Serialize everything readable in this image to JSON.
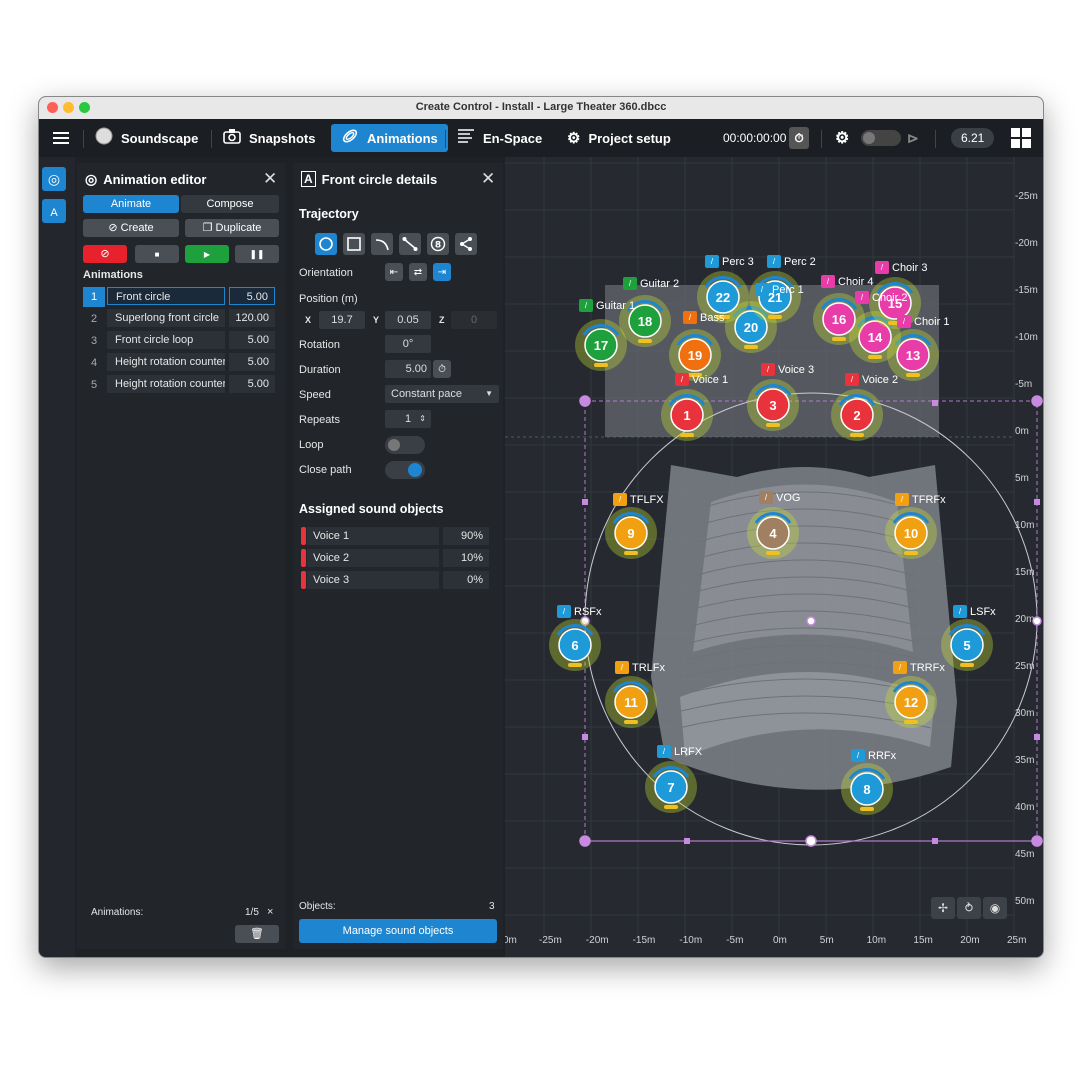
{
  "window": {
    "title": "Create Control - Install - Large Theater 360.dbcc"
  },
  "menubar": {
    "items": [
      {
        "label": "Soundscape",
        "icon": "soundscape-icon"
      },
      {
        "label": "Snapshots",
        "icon": "camera-icon"
      },
      {
        "label": "Animations",
        "icon": "animations-icon",
        "active": true
      },
      {
        "label": "En-Space",
        "icon": "en-space-icon"
      },
      {
        "label": "Project setup",
        "icon": "gears-icon"
      }
    ],
    "timecode": "00:00:00:00",
    "version": "6.21"
  },
  "animation_editor": {
    "title": "Animation editor",
    "tabs": [
      "Animate",
      "Compose"
    ],
    "create_label": "Create",
    "duplicate_label": "Duplicate",
    "section": "Animations",
    "animations": [
      {
        "num": "1",
        "name": "Front circle",
        "value": "5.00"
      },
      {
        "num": "2",
        "name": "Superlong front circle",
        "value": "120.00"
      },
      {
        "num": "3",
        "name": "Front circle loop",
        "value": "5.00"
      },
      {
        "num": "4",
        "name": "Height rotation counter",
        "value": "5.00"
      },
      {
        "num": "5",
        "name": "Height rotation counter",
        "value": "5.00"
      }
    ],
    "footer_label": "Animations:",
    "footer_count": "1/5",
    "footer_close": "×"
  },
  "details": {
    "title": "Front circle details",
    "trajectory_label": "Trajectory",
    "orientation_label": "Orientation",
    "position_label": "Position (m)",
    "x_label": "X",
    "x_value": "19.7",
    "y_label": "Y",
    "y_value": "0.05",
    "z_label": "Z",
    "z_value": "0",
    "rotation_label": "Rotation",
    "rotation_value": "0°",
    "duration_label": "Duration",
    "duration_value": "5.00",
    "speed_label": "Speed",
    "speed_value": "Constant pace",
    "repeats_label": "Repeats",
    "repeats_value": "1",
    "loop_label": "Loop",
    "loop_on": false,
    "close_path_label": "Close path",
    "close_path_on": true,
    "assigned_label": "Assigned sound objects",
    "assigned": [
      {
        "name": "Voice 1",
        "value": "90%"
      },
      {
        "name": "Voice 2",
        "value": "10%"
      },
      {
        "name": "Voice 3",
        "value": "0%"
      }
    ],
    "objects_label": "Objects:",
    "objects_count": "3",
    "manage_label": "Manage sound objects"
  },
  "canvas": {
    "y_axis": [
      "-25m",
      "-20m",
      "-15m",
      "-10m",
      "-5m",
      "0m",
      "5m",
      "10m",
      "15m",
      "20m",
      "25m",
      "30m",
      "35m",
      "40m",
      "45m",
      "50m"
    ],
    "x_axis": [
      "0m",
      "-25m",
      "-20m",
      "-15m",
      "-10m",
      "-5m",
      "0m",
      "5m",
      "10m",
      "15m",
      "20m",
      "25m"
    ],
    "objects": [
      {
        "num": "1",
        "label": "Voice 1",
        "color": "#e8323c"
      },
      {
        "num": "2",
        "label": "Voice 2",
        "color": "#e8323c"
      },
      {
        "num": "3",
        "label": "Voice 3",
        "color": "#e8323c"
      },
      {
        "num": "4",
        "label": "VOG",
        "color": "#a08060"
      },
      {
        "num": "5",
        "label": "LSFx",
        "color": "#1e9ad8"
      },
      {
        "num": "6",
        "label": "RSFx",
        "color": "#1e9ad8"
      },
      {
        "num": "7",
        "label": "LRFX",
        "color": "#1e9ad8"
      },
      {
        "num": "8",
        "label": "RRFx",
        "color": "#1e9ad8"
      },
      {
        "num": "9",
        "label": "TFLFX",
        "color": "#f0a010"
      },
      {
        "num": "10",
        "label": "TFRFx",
        "color": "#f0a010"
      },
      {
        "num": "11",
        "label": "TRLFx",
        "color": "#f0a010"
      },
      {
        "num": "12",
        "label": "TRRFx",
        "color": "#f0a010"
      },
      {
        "num": "13",
        "label": "Choir 1",
        "color": "#e83ca8"
      },
      {
        "num": "14",
        "label": "Choir 2",
        "color": "#e83ca8"
      },
      {
        "num": "15",
        "label": "Choir 3",
        "color": "#e83ca8"
      },
      {
        "num": "16",
        "label": "Choir 4",
        "color": "#e83ca8"
      },
      {
        "num": "17",
        "label": "Guitar 1",
        "color": "#1ea03c"
      },
      {
        "num": "18",
        "label": "Guitar 2",
        "color": "#1ea03c"
      },
      {
        "num": "19",
        "label": "Bass",
        "color": "#f07010"
      },
      {
        "num": "20",
        "label": "",
        "color": "#1e9ad8"
      },
      {
        "num": "21",
        "label": "Perc 1",
        "color": "#1e9ad8"
      },
      {
        "num": "22",
        "label": "Perc 3",
        "color": "#1e9ad8"
      },
      {
        "num": "",
        "label": "Perc 2",
        "color": "#1e9ad8"
      }
    ]
  },
  "colors": {
    "accent": "#1e86d0",
    "record": "#e8222c",
    "play": "#1ea03c"
  }
}
